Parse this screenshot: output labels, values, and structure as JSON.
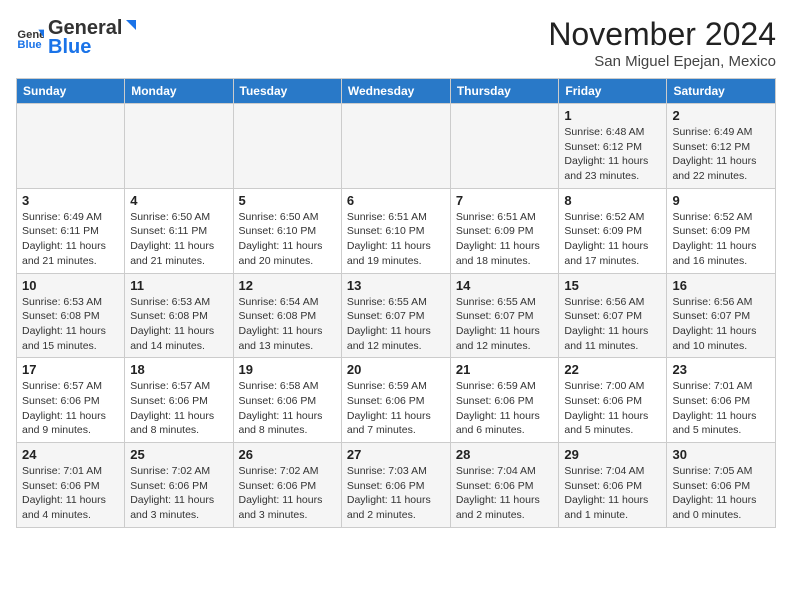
{
  "logo": {
    "general": "General",
    "blue": "Blue"
  },
  "title": "November 2024",
  "location": "San Miguel Epejan, Mexico",
  "days_of_week": [
    "Sunday",
    "Monday",
    "Tuesday",
    "Wednesday",
    "Thursday",
    "Friday",
    "Saturday"
  ],
  "weeks": [
    [
      {
        "day": "",
        "info": ""
      },
      {
        "day": "",
        "info": ""
      },
      {
        "day": "",
        "info": ""
      },
      {
        "day": "",
        "info": ""
      },
      {
        "day": "",
        "info": ""
      },
      {
        "day": "1",
        "info": "Sunrise: 6:48 AM\nSunset: 6:12 PM\nDaylight: 11 hours and 23 minutes."
      },
      {
        "day": "2",
        "info": "Sunrise: 6:49 AM\nSunset: 6:12 PM\nDaylight: 11 hours and 22 minutes."
      }
    ],
    [
      {
        "day": "3",
        "info": "Sunrise: 6:49 AM\nSunset: 6:11 PM\nDaylight: 11 hours and 21 minutes."
      },
      {
        "day": "4",
        "info": "Sunrise: 6:50 AM\nSunset: 6:11 PM\nDaylight: 11 hours and 21 minutes."
      },
      {
        "day": "5",
        "info": "Sunrise: 6:50 AM\nSunset: 6:10 PM\nDaylight: 11 hours and 20 minutes."
      },
      {
        "day": "6",
        "info": "Sunrise: 6:51 AM\nSunset: 6:10 PM\nDaylight: 11 hours and 19 minutes."
      },
      {
        "day": "7",
        "info": "Sunrise: 6:51 AM\nSunset: 6:09 PM\nDaylight: 11 hours and 18 minutes."
      },
      {
        "day": "8",
        "info": "Sunrise: 6:52 AM\nSunset: 6:09 PM\nDaylight: 11 hours and 17 minutes."
      },
      {
        "day": "9",
        "info": "Sunrise: 6:52 AM\nSunset: 6:09 PM\nDaylight: 11 hours and 16 minutes."
      }
    ],
    [
      {
        "day": "10",
        "info": "Sunrise: 6:53 AM\nSunset: 6:08 PM\nDaylight: 11 hours and 15 minutes."
      },
      {
        "day": "11",
        "info": "Sunrise: 6:53 AM\nSunset: 6:08 PM\nDaylight: 11 hours and 14 minutes."
      },
      {
        "day": "12",
        "info": "Sunrise: 6:54 AM\nSunset: 6:08 PM\nDaylight: 11 hours and 13 minutes."
      },
      {
        "day": "13",
        "info": "Sunrise: 6:55 AM\nSunset: 6:07 PM\nDaylight: 11 hours and 12 minutes."
      },
      {
        "day": "14",
        "info": "Sunrise: 6:55 AM\nSunset: 6:07 PM\nDaylight: 11 hours and 12 minutes."
      },
      {
        "day": "15",
        "info": "Sunrise: 6:56 AM\nSunset: 6:07 PM\nDaylight: 11 hours and 11 minutes."
      },
      {
        "day": "16",
        "info": "Sunrise: 6:56 AM\nSunset: 6:07 PM\nDaylight: 11 hours and 10 minutes."
      }
    ],
    [
      {
        "day": "17",
        "info": "Sunrise: 6:57 AM\nSunset: 6:06 PM\nDaylight: 11 hours and 9 minutes."
      },
      {
        "day": "18",
        "info": "Sunrise: 6:57 AM\nSunset: 6:06 PM\nDaylight: 11 hours and 8 minutes."
      },
      {
        "day": "19",
        "info": "Sunrise: 6:58 AM\nSunset: 6:06 PM\nDaylight: 11 hours and 8 minutes."
      },
      {
        "day": "20",
        "info": "Sunrise: 6:59 AM\nSunset: 6:06 PM\nDaylight: 11 hours and 7 minutes."
      },
      {
        "day": "21",
        "info": "Sunrise: 6:59 AM\nSunset: 6:06 PM\nDaylight: 11 hours and 6 minutes."
      },
      {
        "day": "22",
        "info": "Sunrise: 7:00 AM\nSunset: 6:06 PM\nDaylight: 11 hours and 5 minutes."
      },
      {
        "day": "23",
        "info": "Sunrise: 7:01 AM\nSunset: 6:06 PM\nDaylight: 11 hours and 5 minutes."
      }
    ],
    [
      {
        "day": "24",
        "info": "Sunrise: 7:01 AM\nSunset: 6:06 PM\nDaylight: 11 hours and 4 minutes."
      },
      {
        "day": "25",
        "info": "Sunrise: 7:02 AM\nSunset: 6:06 PM\nDaylight: 11 hours and 3 minutes."
      },
      {
        "day": "26",
        "info": "Sunrise: 7:02 AM\nSunset: 6:06 PM\nDaylight: 11 hours and 3 minutes."
      },
      {
        "day": "27",
        "info": "Sunrise: 7:03 AM\nSunset: 6:06 PM\nDaylight: 11 hours and 2 minutes."
      },
      {
        "day": "28",
        "info": "Sunrise: 7:04 AM\nSunset: 6:06 PM\nDaylight: 11 hours and 2 minutes."
      },
      {
        "day": "29",
        "info": "Sunrise: 7:04 AM\nSunset: 6:06 PM\nDaylight: 11 hours and 1 minute."
      },
      {
        "day": "30",
        "info": "Sunrise: 7:05 AM\nSunset: 6:06 PM\nDaylight: 11 hours and 0 minutes."
      }
    ]
  ]
}
